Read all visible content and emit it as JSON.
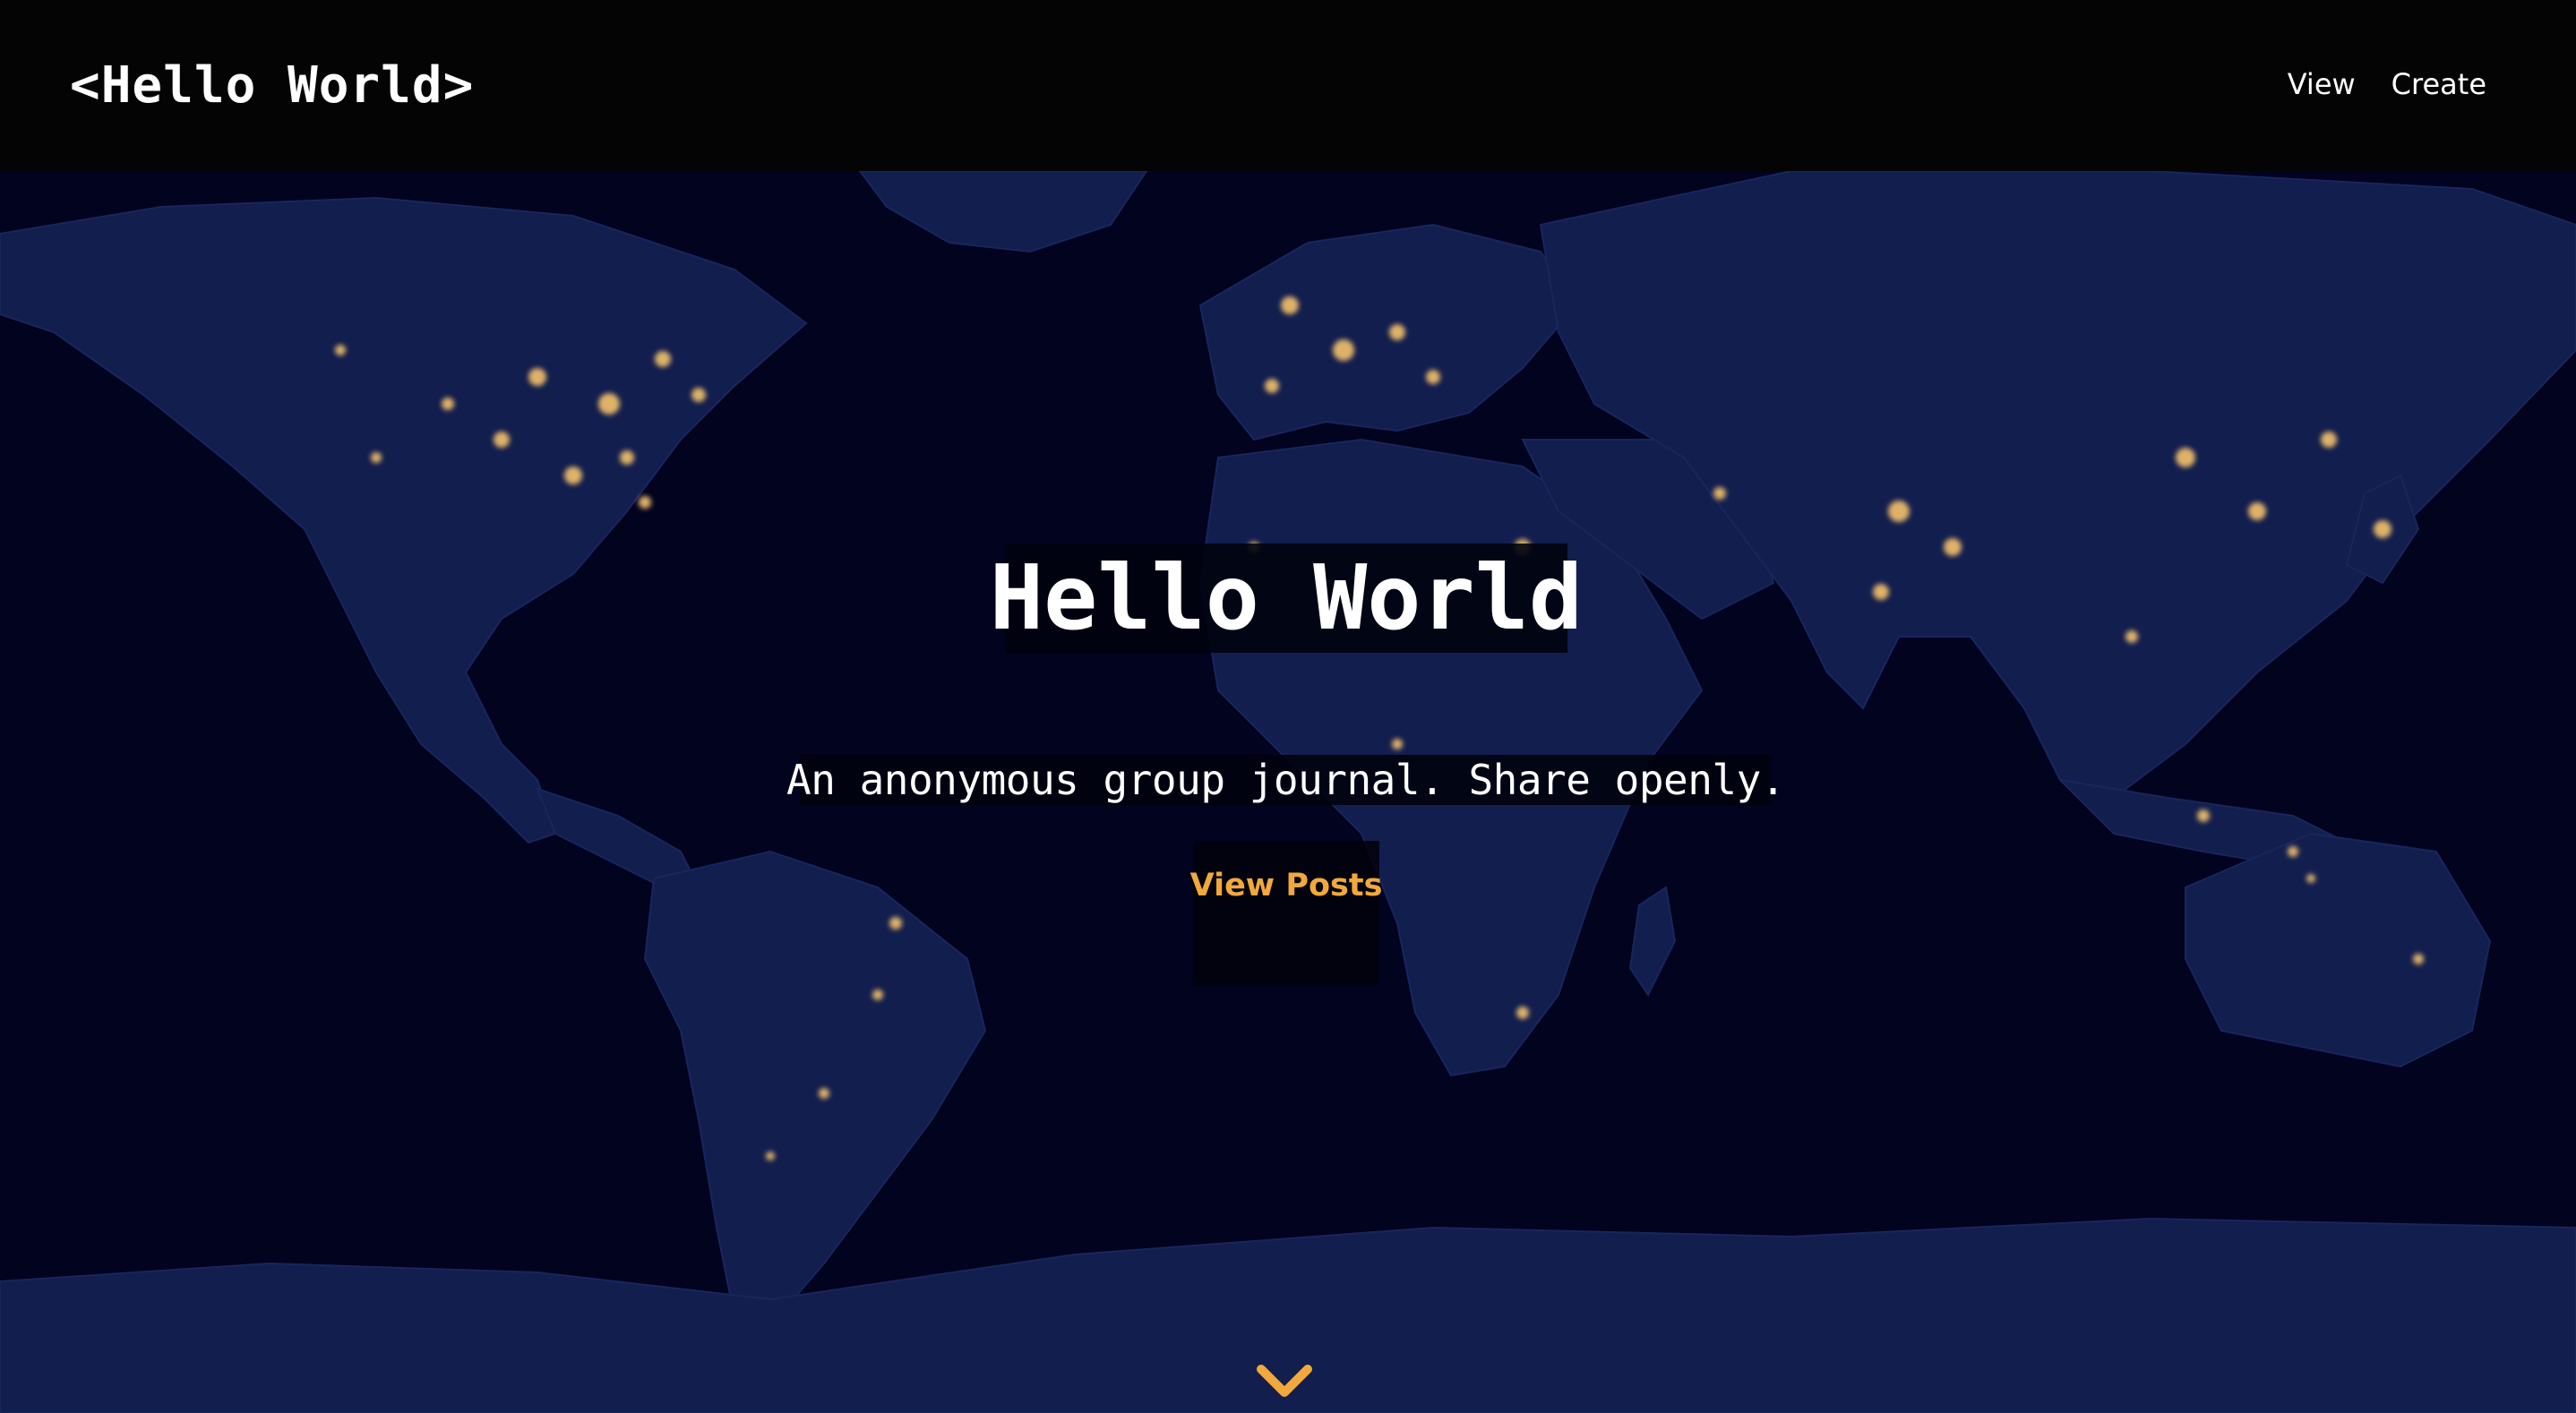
{
  "header": {
    "brand": "<Hello World>",
    "nav": [
      {
        "label": "View"
      },
      {
        "label": "Create"
      }
    ]
  },
  "hero": {
    "title": "Hello World",
    "subtitle": "An anonymous group journal. Share openly.",
    "cta_label": "View Posts",
    "background": "world-map-night-lights",
    "scroll_icon": "chevron-down-icon"
  },
  "colors": {
    "accent": "#f2a93b",
    "header_bg": "#040404",
    "ocean": "#02031f",
    "land": "#121e4e",
    "city_lights": "#f6c36a"
  }
}
